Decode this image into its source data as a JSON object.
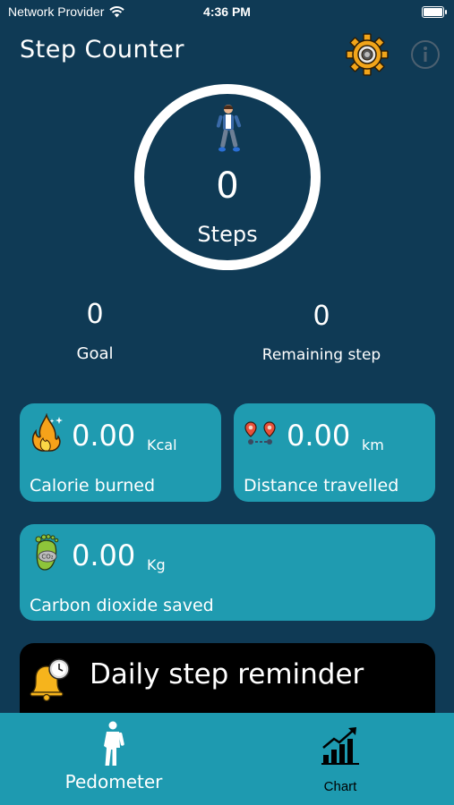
{
  "status": {
    "carrier": "Network Provider",
    "time": "4:36 PM"
  },
  "header": {
    "title": "Step Counter",
    "settings_icon": "gear-icon",
    "info_icon": "info-icon"
  },
  "steps": {
    "count": "0",
    "label": "Steps"
  },
  "goal": {
    "value": "0",
    "label": "Goal"
  },
  "remaining": {
    "value": "0",
    "label": "Remaining step"
  },
  "calorie": {
    "value": "0.00",
    "unit": "Kcal",
    "label": "Calorie burned"
  },
  "distance": {
    "value": "0.00",
    "unit": "km",
    "label": "Distance travelled"
  },
  "carbon": {
    "value": "0.00",
    "unit": "Kg",
    "label": "Carbon dioxide saved"
  },
  "reminder": {
    "label": "Daily step reminder"
  },
  "nav": {
    "pedometer": "Pedometer",
    "chart": "Chart"
  },
  "colors": {
    "background": "#0f3a55",
    "card": "#1f9bb0",
    "nav": "#1e9ab0"
  }
}
